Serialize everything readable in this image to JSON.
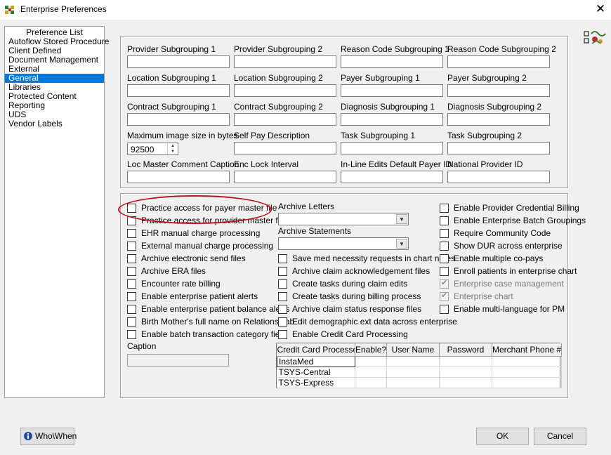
{
  "window": {
    "title": "Enterprise Preferences",
    "close_glyph": "✕"
  },
  "preference_list": {
    "heading": "Preference List",
    "items": [
      {
        "label": "Autoflow Stored Procedure"
      },
      {
        "label": "Client Defined"
      },
      {
        "label": "Document Management"
      },
      {
        "label": "External"
      },
      {
        "label": "General",
        "selected": true
      },
      {
        "label": "Libraries"
      },
      {
        "label": "Protected Content"
      },
      {
        "label": "Reporting"
      },
      {
        "label": "UDS"
      },
      {
        "label": "Vendor Labels"
      }
    ]
  },
  "fields": {
    "provider_subgrouping_1": {
      "label": "Provider Subgrouping 1",
      "value": ""
    },
    "provider_subgrouping_2": {
      "label": "Provider Subgrouping 2",
      "value": ""
    },
    "reason_code_subgrouping_1": {
      "label": "Reason Code Subgrouping 1",
      "value": ""
    },
    "reason_code_subgrouping_2": {
      "label": "Reason Code Subgrouping 2",
      "value": ""
    },
    "location_subgrouping_1": {
      "label": "Location Subgrouping 1",
      "value": ""
    },
    "location_subgrouping_2": {
      "label": "Location Subgrouping 2",
      "value": ""
    },
    "payer_subgrouping_1": {
      "label": "Payer Subgrouping 1",
      "value": ""
    },
    "payer_subgrouping_2": {
      "label": "Payer Subgrouping 2",
      "value": ""
    },
    "contract_subgrouping_1": {
      "label": "Contract Subgrouping 1",
      "value": ""
    },
    "contract_subgrouping_2": {
      "label": "Contract Subgrouping 2",
      "value": ""
    },
    "diagnosis_subgrouping_1": {
      "label": "Diagnosis Subgrouping 1",
      "value": ""
    },
    "diagnosis_subgrouping_2": {
      "label": "Diagnosis Subgrouping 2",
      "value": ""
    },
    "max_image_size": {
      "label": "Maximum image size in bytes",
      "value": "92500"
    },
    "self_pay_description": {
      "label": "Self Pay Description",
      "value": ""
    },
    "task_subgrouping_1": {
      "label": "Task Subgrouping 1",
      "value": ""
    },
    "task_subgrouping_2": {
      "label": "Task Subgrouping 2",
      "value": ""
    },
    "loc_master_comment_caption": {
      "label": "Loc Master Comment Caption",
      "value": ""
    },
    "enc_lock_interval": {
      "label": "Enc Lock Interval",
      "value": ""
    },
    "inline_edits_default_payer_id": {
      "label": "In-Line Edits Default Payer ID",
      "value": ""
    },
    "national_provider_id": {
      "label": "National Provider ID",
      "value": ""
    }
  },
  "checkboxes_col1": [
    {
      "label": "Practice access for payer master file",
      "checked": false
    },
    {
      "label": "Practice access for provider master file",
      "checked": false
    },
    {
      "label": "EHR manual charge processing",
      "checked": false
    },
    {
      "label": "External manual charge processing",
      "checked": false
    },
    {
      "label": "Archive electronic send files",
      "checked": false
    },
    {
      "label": "Archive ERA files",
      "checked": false
    },
    {
      "label": "Encounter rate billing",
      "checked": false
    },
    {
      "label": "Enable enterprise patient alerts",
      "checked": false
    },
    {
      "label": "Enable enterprise patient balance alerts",
      "checked": false
    },
    {
      "label": "Birth Mother's full name on Relations Tab",
      "checked": false
    },
    {
      "label": "Enable batch transaction category field",
      "checked": false
    }
  ],
  "caption": {
    "label": "Caption",
    "value": ""
  },
  "archive_letters": {
    "label": "Archive Letters",
    "value": ""
  },
  "archive_statements": {
    "label": "Archive Statements",
    "value": ""
  },
  "checkboxes_col2": [
    {
      "label": "Save med necessity requests in chart notes",
      "checked": false
    },
    {
      "label": "Archive claim acknowledgement files",
      "checked": false
    },
    {
      "label": "Create tasks during claim edits",
      "checked": false
    },
    {
      "label": "Create tasks during billing process",
      "checked": false
    },
    {
      "label": "Archive claim status response files",
      "checked": false
    },
    {
      "label": "Edit demographic ext data across enterprise",
      "checked": false
    },
    {
      "label": "Enable Credit Card Processing",
      "checked": false
    }
  ],
  "checkboxes_col3": [
    {
      "label": "Enable Provider Credential Billing",
      "checked": false
    },
    {
      "label": "Enable Enterprise Batch Groupings",
      "checked": false
    },
    {
      "label": "Require Community Code",
      "checked": false
    },
    {
      "label": "Show DUR across enterprise",
      "checked": false
    },
    {
      "label": "Enable multiple co-pays",
      "checked": false
    },
    {
      "label": "Enroll patients in enterprise chart",
      "checked": false
    },
    {
      "label": "Enterprise case management",
      "checked": true,
      "disabled": true
    },
    {
      "label": "Enterprise chart",
      "checked": true,
      "disabled": true
    },
    {
      "label": "Enable multi-language for PM",
      "checked": false
    }
  ],
  "processor_grid": {
    "columns": [
      "Credit Card Processor",
      "Enable?",
      "User Name",
      "Password",
      "Merchant Phone #"
    ],
    "rows": [
      [
        "InstaMed",
        "",
        "",
        "",
        ""
      ],
      [
        "TSYS-Central",
        "",
        "",
        "",
        ""
      ],
      [
        "TSYS-Express",
        "",
        "",
        "",
        ""
      ]
    ]
  },
  "buttons": {
    "who_when": "Who\\When",
    "ok": "OK",
    "cancel": "Cancel"
  },
  "colors": {
    "selection": "#0078d7",
    "annotation": "#b8141c"
  }
}
